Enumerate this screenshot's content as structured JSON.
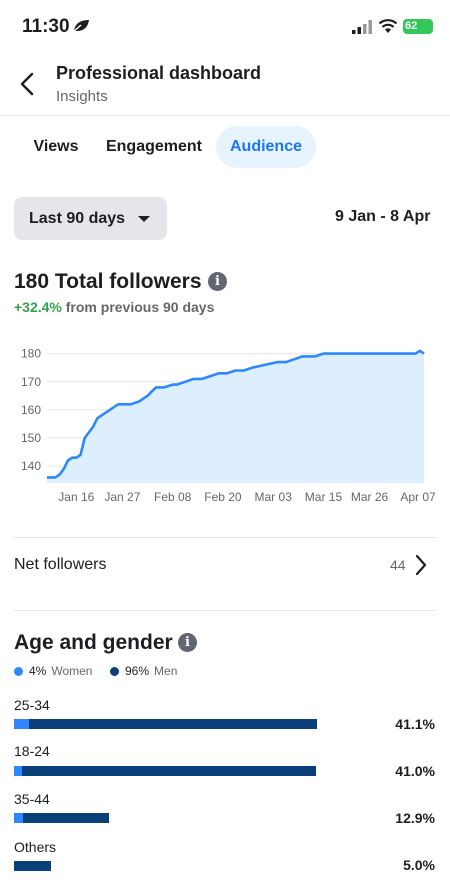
{
  "status": {
    "time": "11:30",
    "battery": "62"
  },
  "header": {
    "title": "Professional dashboard",
    "subtitle": "Insights"
  },
  "tabs": [
    {
      "label": "Views"
    },
    {
      "label": "Engagement"
    },
    {
      "label": "Audience",
      "active": true
    }
  ],
  "filter": {
    "range_label": "Last 90 days",
    "date_range": "9 Jan - 8 Apr"
  },
  "followers": {
    "title": "180 Total followers",
    "growth_pct": "+32.4%",
    "growth_text": "from previous 90 days"
  },
  "chart_data": {
    "type": "area",
    "x": [
      "2024-01-09",
      "2024-01-11",
      "2024-01-12",
      "2024-01-13",
      "2024-01-14",
      "2024-01-15",
      "2024-01-16",
      "2024-01-17",
      "2024-01-18",
      "2024-01-19",
      "2024-01-20",
      "2024-01-21",
      "2024-01-22",
      "2024-01-23",
      "2024-01-24",
      "2024-01-25",
      "2024-01-26",
      "2024-01-29",
      "2024-01-31",
      "2024-02-02",
      "2024-02-04",
      "2024-02-06",
      "2024-02-08",
      "2024-02-09",
      "2024-02-11",
      "2024-02-13",
      "2024-02-15",
      "2024-02-17",
      "2024-02-19",
      "2024-02-21",
      "2024-02-23",
      "2024-02-25",
      "2024-02-27",
      "2024-03-01",
      "2024-03-04",
      "2024-03-06",
      "2024-03-08",
      "2024-03-10",
      "2024-03-13",
      "2024-03-15",
      "2024-03-20",
      "2024-03-25",
      "2024-03-30",
      "2024-04-04",
      "2024-04-06",
      "2024-04-07",
      "2024-04-08"
    ],
    "values": [
      136,
      136,
      137,
      139,
      142,
      143,
      143,
      144,
      150,
      152,
      154,
      157,
      158,
      159,
      160,
      161,
      162,
      162,
      163,
      165,
      168,
      168,
      169,
      169,
      170,
      171,
      171,
      172,
      173,
      173,
      174,
      174,
      175,
      176,
      177,
      177,
      178,
      179,
      179,
      180,
      180,
      180,
      180,
      180,
      180,
      181,
      180
    ],
    "x_ticks": [
      "Jan 16",
      "Jan 27",
      "Feb 08",
      "Feb 20",
      "Mar 03",
      "Mar 15",
      "Mar 26",
      "Apr 07"
    ],
    "y_ticks": [
      140,
      150,
      160,
      170,
      180
    ],
    "ylim": [
      134,
      182
    ],
    "grid": true,
    "line_color": "#2d88ff",
    "fill_color": "#ddeeff"
  },
  "net_followers": {
    "label": "Net followers",
    "value": "44"
  },
  "age_gender": {
    "title": "Age and gender",
    "women": {
      "pct": "4%",
      "label": "Women",
      "color": "#2d88ff"
    },
    "men": {
      "pct": "96%",
      "label": "Men",
      "color": "#0b3f7a"
    },
    "groups": [
      {
        "label": "25-34",
        "pct": "41.1%",
        "value": 41.1,
        "women_share": 0.05
      },
      {
        "label": "18-24",
        "pct": "41.0%",
        "value": 41.0,
        "women_share": 0.025
      },
      {
        "label": "35-44",
        "pct": "12.9%",
        "value": 12.9,
        "women_share": 0.09
      },
      {
        "label": "Others",
        "pct": "5.0%",
        "value": 5.0,
        "women_share": 0
      }
    ]
  }
}
